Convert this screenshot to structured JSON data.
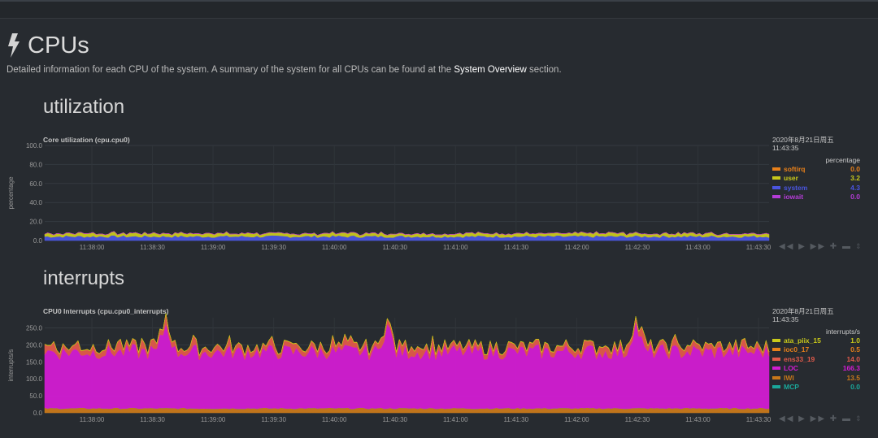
{
  "page": {
    "title": "CPUs",
    "description_pre": "Detailed information for each CPU of the system. A summary of the system for all CPUs can be found at the",
    "description_link": "System Overview",
    "description_post": "section."
  },
  "sections": {
    "utilization": "utilization",
    "interrupts": "interrupts"
  },
  "chart_data": [
    {
      "type": "area",
      "title": "Core utilization (cpu.cpu0)",
      "ylabel": "percentage",
      "units": "percentage",
      "legend_date": "2020年8月21日周五",
      "legend_time": "11:43:35",
      "ylim": [
        0,
        100
      ],
      "yticks": [
        "100.0",
        "80.0",
        "60.0",
        "40.0",
        "20.0",
        "0.0"
      ],
      "x": [
        "11:38:00",
        "11:38:30",
        "11:39:00",
        "11:39:30",
        "11:40:00",
        "11:40:30",
        "11:41:00",
        "11:41:30",
        "11:42:00",
        "11:42:30",
        "11:43:00",
        "11:43:30"
      ],
      "grid": true,
      "series": [
        {
          "name": "softirq",
          "value": "0.0",
          "color": "#e8801a",
          "level": 0.0
        },
        {
          "name": "user",
          "value": "3.2",
          "color": "#c9c91a",
          "level": 3.2
        },
        {
          "name": "system",
          "value": "4.3",
          "color": "#4a55e0",
          "level": 4.3
        },
        {
          "name": "iowait",
          "value": "0.0",
          "color": "#b43cd6",
          "level": 0.0
        }
      ]
    },
    {
      "type": "area",
      "title": "CPU0 Interrupts (cpu.cpu0_interrupts)",
      "ylabel": "interrupts/s",
      "units": "interrupts/s",
      "legend_date": "2020年8月21日周五",
      "legend_time": "11:43:35",
      "ylim": [
        0,
        280
      ],
      "yticks": [
        "250.0",
        "200.0",
        "150.0",
        "100.0",
        "50.0",
        "0.0"
      ],
      "x": [
        "11:38:00",
        "11:38:30",
        "11:39:00",
        "11:39:30",
        "11:40:00",
        "11:40:30",
        "11:41:00",
        "11:41:30",
        "11:42:00",
        "11:42:30",
        "11:43:00",
        "11:43:30"
      ],
      "grid": true,
      "series": [
        {
          "name": "ata_piix_15",
          "value": "1.0",
          "color": "#c9c91a",
          "level": 1.0
        },
        {
          "name": "ioc0_17",
          "value": "0.5",
          "color": "#e8801a",
          "level": 0.5
        },
        {
          "name": "ens33_19",
          "value": "14.0",
          "color": "#e05a4a",
          "level": 14.0
        },
        {
          "name": "LOC",
          "value": "166.3",
          "color": "#d21cd2",
          "level": 166.3
        },
        {
          "name": "IWI",
          "value": "13.5",
          "color": "#c8781a",
          "level": 13.5
        },
        {
          "name": "MCP",
          "value": "0.0",
          "color": "#1aa89a",
          "level": 0.0
        }
      ]
    }
  ],
  "controls": {
    "symbols": "◀◀ ▶ ▶▶ ✚ ▬",
    "resize": "⇕"
  }
}
